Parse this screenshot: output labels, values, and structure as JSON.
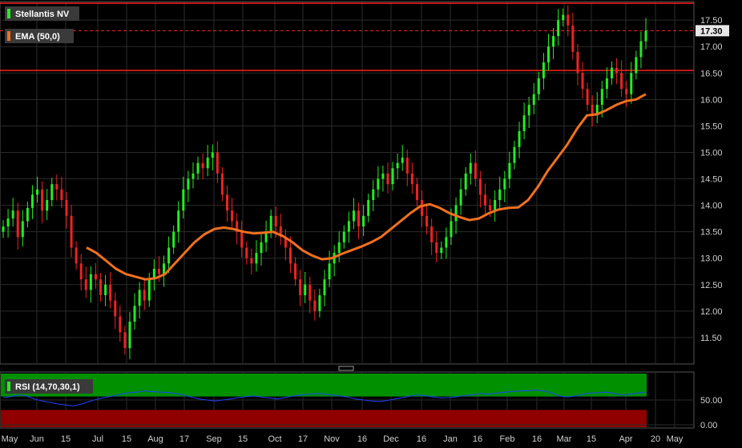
{
  "chart_data": {
    "type": "candlestick",
    "title": "Stellantis NV",
    "indicators": [
      {
        "name": "EMA (50,0)",
        "color": "#f07020"
      },
      {
        "name": "RSI (14,70,30,1)",
        "color": "#2040ff"
      }
    ],
    "last_price": "17.30",
    "price_axis_ticks": [
      "17.50",
      "17.00",
      "16.50",
      "16.00",
      "15.50",
      "15.00",
      "14.50",
      "14.00",
      "13.50",
      "13.00",
      "12.50",
      "12.00",
      "11.50"
    ],
    "price_ylim": [
      11.0,
      17.85
    ],
    "rsi_axis_ticks": [
      "50.00",
      "0.00"
    ],
    "rsi_ylim": [
      0,
      100
    ],
    "resistance_levels": [
      17.82,
      16.55
    ],
    "x_axis_labels": [
      "May",
      "Jun",
      "15",
      "Jul",
      "15",
      "Aug",
      "17",
      "Sep",
      "15",
      "Oct",
      "17",
      "Nov",
      "16",
      "Dec",
      "16",
      "Jan",
      "16",
      "Feb",
      "16",
      "Mar",
      "15",
      "Apr",
      "20",
      "May"
    ],
    "close_series": [
      13.6,
      13.75,
      13.9,
      13.4,
      13.7,
      13.95,
      14.2,
      14.3,
      13.9,
      14.1,
      14.4,
      14.3,
      14.1,
      13.8,
      13.2,
      12.9,
      12.6,
      12.4,
      12.7,
      12.6,
      12.3,
      12.5,
      12.2,
      11.9,
      11.6,
      11.3,
      11.8,
      12.1,
      12.4,
      12.2,
      12.6,
      12.8,
      12.7,
      12.9,
      13.2,
      13.5,
      13.9,
      14.3,
      14.5,
      14.6,
      14.8,
      14.7,
      14.9,
      15.0,
      14.6,
      14.2,
      13.9,
      13.7,
      13.5,
      13.2,
      13.0,
      12.9,
      13.1,
      13.3,
      13.5,
      13.8,
      13.6,
      13.4,
      13.2,
      12.9,
      12.6,
      12.3,
      12.5,
      12.2,
      12.0,
      12.3,
      12.6,
      12.9,
      13.1,
      13.3,
      13.5,
      13.7,
      13.9,
      13.6,
      13.8,
      14.1,
      14.3,
      14.5,
      14.6,
      14.4,
      14.7,
      14.8,
      14.9,
      14.6,
      14.4,
      14.1,
      13.8,
      13.6,
      13.3,
      13.1,
      13.2,
      13.4,
      13.7,
      14.0,
      14.3,
      14.6,
      14.8,
      14.5,
      14.2,
      14.0,
      13.9,
      14.1,
      14.3,
      14.5,
      14.8,
      15.1,
      15.4,
      15.7,
      15.9,
      16.1,
      16.4,
      16.7,
      17.0,
      17.2,
      17.5,
      17.6,
      17.4,
      16.9,
      16.5,
      16.2,
      15.9,
      15.7,
      15.9,
      16.2,
      16.4,
      16.6,
      16.5,
      16.2,
      16.1,
      16.5,
      16.8,
      17.1,
      17.3
    ],
    "ema_series": [
      13.2,
      13.1,
      12.95,
      12.8,
      12.7,
      12.65,
      12.6,
      12.62,
      12.7,
      12.9,
      13.1,
      13.3,
      13.45,
      13.55,
      13.58,
      13.55,
      13.5,
      13.47,
      13.48,
      13.5,
      13.42,
      13.3,
      13.15,
      13.05,
      12.98,
      13.0,
      13.08,
      13.15,
      13.22,
      13.3,
      13.4,
      13.55,
      13.7,
      13.85,
      13.98,
      14.02,
      13.95,
      13.85,
      13.78,
      13.72,
      13.75,
      13.85,
      13.92,
      13.95,
      13.96,
      14.1,
      14.35,
      14.65,
      14.9,
      15.15,
      15.45,
      15.7,
      15.72,
      15.8,
      15.9,
      15.97,
      16.0,
      16.1
    ],
    "rsi_series": [
      55,
      57,
      60,
      58,
      52,
      48,
      45,
      42,
      40,
      38,
      42,
      47,
      52,
      55,
      58,
      62,
      65,
      66,
      68,
      67,
      66,
      65,
      63,
      60,
      56,
      52,
      50,
      48,
      50,
      52,
      55,
      57,
      58,
      56,
      54,
      52,
      55,
      58,
      60,
      62,
      63,
      62,
      60,
      58,
      56,
      52,
      50,
      48,
      47,
      49,
      52,
      55,
      58,
      60,
      58,
      56,
      54,
      55,
      57,
      59,
      61,
      63,
      62,
      64,
      66,
      67,
      68,
      69,
      70,
      68,
      64,
      58,
      56,
      58,
      62,
      64,
      65,
      66,
      63,
      60,
      62,
      64,
      66
    ]
  }
}
